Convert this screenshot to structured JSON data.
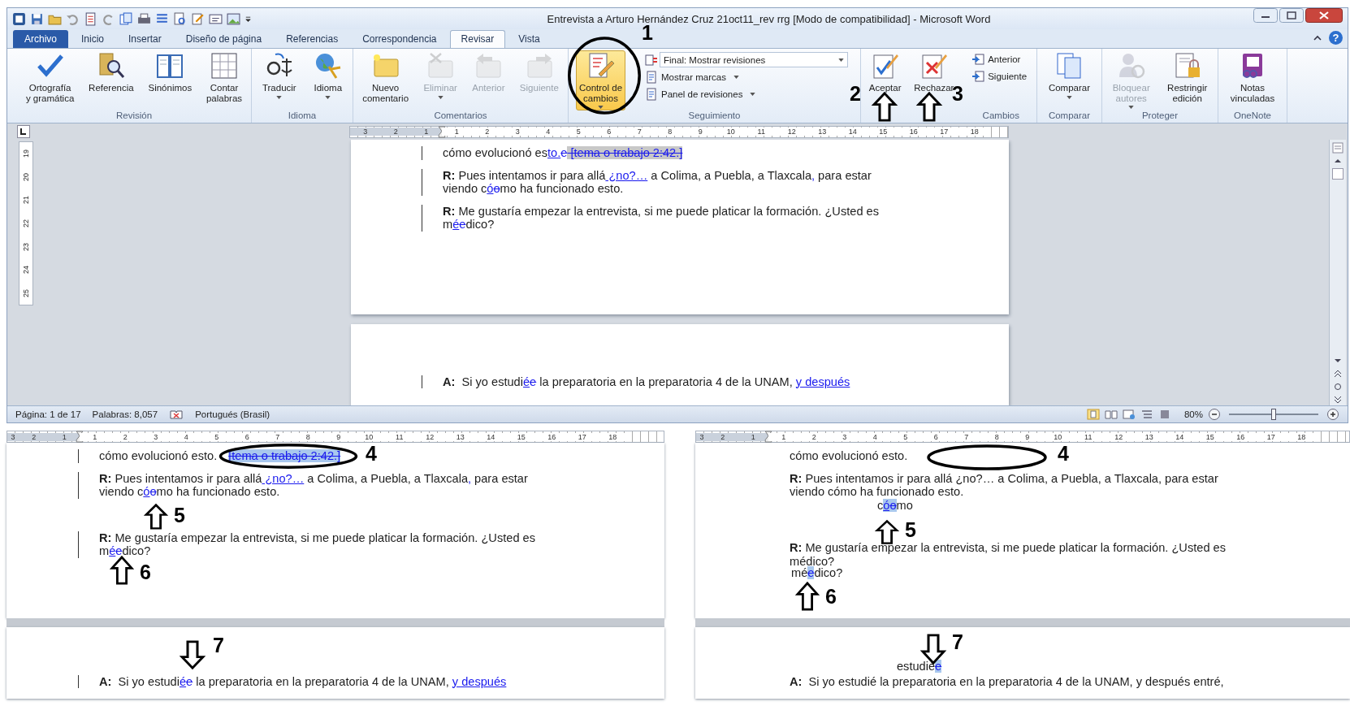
{
  "window": {
    "title": "Entrevista a Arturo Hernández Cruz 21oct11_rev rrg [Modo de compatibilidad]  -  Microsoft Word",
    "help": "?"
  },
  "tabs": [
    {
      "label": "Archivo",
      "selected": false,
      "kind": "file"
    },
    {
      "label": "Inicio",
      "selected": false,
      "kind": "tab"
    },
    {
      "label": "Insertar",
      "selected": false,
      "kind": "tab"
    },
    {
      "label": "Diseño de página",
      "selected": false,
      "kind": "tab"
    },
    {
      "label": "Referencias",
      "selected": false,
      "kind": "tab"
    },
    {
      "label": "Correspondencia",
      "selected": false,
      "kind": "tab"
    },
    {
      "label": "Revisar",
      "selected": true,
      "kind": "tab"
    },
    {
      "label": "Vista",
      "selected": false,
      "kind": "tab"
    }
  ],
  "ribbon": [
    {
      "label": "Revisión",
      "items": [
        {
          "kind": "large",
          "label": "Ortografía\ny gramática",
          "disabled": false,
          "menu": false,
          "on": false
        },
        {
          "kind": "large",
          "label": "Referencia",
          "disabled": false,
          "menu": false,
          "on": false
        },
        {
          "kind": "large",
          "label": "Sinónimos",
          "disabled": false,
          "menu": false,
          "on": false
        },
        {
          "kind": "large",
          "label": "Contar\npalabras",
          "disabled": false,
          "menu": false,
          "on": false
        }
      ]
    },
    {
      "label": "Idioma",
      "items": [
        {
          "kind": "large",
          "label": "Traducir",
          "disabled": false,
          "menu": true,
          "on": false
        },
        {
          "kind": "large",
          "label": "Idioma",
          "disabled": false,
          "menu": true,
          "on": false
        }
      ]
    },
    {
      "label": "Comentarios",
      "items": [
        {
          "kind": "large",
          "label": "Nuevo\ncomentario",
          "disabled": false,
          "menu": false,
          "on": false
        },
        {
          "kind": "large",
          "label": "Eliminar",
          "disabled": true,
          "menu": true,
          "on": false
        },
        {
          "kind": "large",
          "label": "Anterior",
          "disabled": true,
          "menu": false,
          "on": false
        },
        {
          "kind": "large",
          "label": "Siguiente",
          "disabled": true,
          "menu": false,
          "on": false
        }
      ]
    },
    {
      "label": "Seguimiento",
      "items": [
        {
          "kind": "large",
          "label": "Control de\ncambios",
          "disabled": false,
          "menu": true,
          "on": true
        },
        {
          "kind": "dropdown",
          "label": "Final: Mostrar revisiones",
          "disabled": false,
          "menu": true,
          "on": false
        },
        {
          "kind": "small",
          "label": "Mostrar marcas",
          "disabled": false,
          "menu": true,
          "on": false
        },
        {
          "kind": "small",
          "label": "Panel de revisiones",
          "disabled": false,
          "menu": true,
          "on": false
        }
      ]
    },
    {
      "label": "Cambios",
      "items": [
        {
          "kind": "large",
          "label": "Aceptar",
          "disabled": false,
          "menu": false,
          "on": false
        },
        {
          "kind": "large",
          "label": "Rechazar",
          "disabled": false,
          "menu": false,
          "on": false
        },
        {
          "kind": "small",
          "label": "Anterior",
          "disabled": false,
          "menu": false,
          "on": false
        },
        {
          "kind": "small",
          "label": "Siguiente",
          "disabled": false,
          "menu": false,
          "on": false
        }
      ]
    },
    {
      "label": "Comparar",
      "items": [
        {
          "kind": "large",
          "label": "Comparar",
          "disabled": false,
          "menu": true,
          "on": false
        }
      ]
    },
    {
      "label": "Proteger",
      "items": [
        {
          "kind": "large",
          "label": "Bloquear\nautores",
          "disabled": true,
          "menu": true,
          "on": false
        },
        {
          "kind": "large",
          "label": "Restringir\nedición",
          "disabled": false,
          "menu": false,
          "on": false
        }
      ]
    },
    {
      "label": "OneNote",
      "items": [
        {
          "kind": "large",
          "label": "Notas\nvinculadas",
          "disabled": false,
          "menu": false,
          "on": false
        }
      ]
    }
  ],
  "document": {
    "ruler": [
      "3",
      "2",
      "1",
      "1",
      "2",
      "3",
      "4",
      "5",
      "6",
      "7",
      "8",
      "9",
      "10",
      "11",
      "12",
      "13",
      "14",
      "15",
      "16",
      "17",
      "18"
    ],
    "vertical_ruler": [
      "19",
      "20",
      "21",
      "22",
      "23",
      "24",
      "25"
    ],
    "page_1": [
      {
        "kind": "text",
        "changed": true,
        "segments": [
          {
            "kind": "normal",
            "text": "cómo evolucionó es"
          },
          {
            "kind": "inserted",
            "text": "to."
          },
          {
            "kind": "deleted",
            "text": "e"
          },
          {
            "kind": "deleted-grey",
            "text": " [tema o trabajo 2:42.]"
          }
        ]
      },
      {
        "kind": "text",
        "changed": true,
        "segments": [
          {
            "kind": "bold",
            "text": "R:"
          },
          {
            "kind": "normal",
            "text": " Pues intentamos ir para allá"
          },
          {
            "kind": "inserted",
            "text": " ¿no?…"
          },
          {
            "kind": "normal",
            "text": " a Colima, a Puebla, a Tlaxcala"
          },
          {
            "kind": "inserted",
            "text": ","
          },
          {
            "kind": "normal",
            "text": " para estar viendo c"
          },
          {
            "kind": "inserted",
            "text": "ó"
          },
          {
            "kind": "deleted",
            "text": "o"
          },
          {
            "kind": "normal",
            "text": "mo ha funcionado esto."
          }
        ]
      },
      {
        "kind": "text",
        "changed": true,
        "segments": [
          {
            "kind": "bold",
            "text": "R:"
          },
          {
            "kind": "normal",
            "text": " Me gustaría empezar la entrevista, si me puede platicar la formación. ¿Usted es m"
          },
          {
            "kind": "inserted",
            "text": "é"
          },
          {
            "kind": "deleted",
            "text": "e"
          },
          {
            "kind": "normal",
            "text": "dico?"
          }
        ]
      }
    ],
    "page_2": [
      {
        "kind": "text",
        "changed": true,
        "segments": [
          {
            "kind": "bold",
            "text": "A:"
          },
          {
            "kind": "normal",
            "text": "  Si yo estudi"
          },
          {
            "kind": "inserted",
            "text": "é"
          },
          {
            "kind": "deleted",
            "text": "e"
          },
          {
            "kind": "normal",
            "text": " la preparatoria en la preparatoria 4 de la UNAM, "
          },
          {
            "kind": "inserted",
            "text": "y después"
          }
        ]
      }
    ]
  },
  "status_bar": {
    "page": "Página: 1 de 17",
    "words": "Palabras: 8,057",
    "language": "Portugués (Brasil)",
    "zoom": "80%",
    "zoom_level": {
      "level": 0.5
    }
  },
  "panels": [
    {
      "ruler": [
        "3",
        "2",
        "1",
        "1",
        "2",
        "3",
        "4",
        "5",
        "6",
        "7",
        "8",
        "9",
        "10",
        "11",
        "12",
        "13",
        "14",
        "15",
        "16",
        "17",
        "18"
      ],
      "page_1": [
        {
          "kind": "text",
          "changed": true,
          "segments": [
            {
              "kind": "normal",
              "text": "cómo evolucionó esto."
            },
            {
              "kind": "deleted-blue",
              "text": "[tema o trabajo 2:42.]"
            }
          ]
        },
        {
          "kind": "text",
          "changed": true,
          "segments": [
            {
              "kind": "bold",
              "text": "R:"
            },
            {
              "kind": "normal",
              "text": " Pues intentamos ir para allá"
            },
            {
              "kind": "inserted",
              "text": " ¿no?…"
            },
            {
              "kind": "normal",
              "text": " a Colima, a Puebla, a Tlaxcala"
            },
            {
              "kind": "inserted",
              "text": ","
            },
            {
              "kind": "normal",
              "text": " para estar viendo c"
            },
            {
              "kind": "inserted",
              "text": "ó"
            },
            {
              "kind": "deleted",
              "text": "o"
            },
            {
              "kind": "normal",
              "text": "mo ha funcionado esto."
            }
          ]
        },
        {
          "kind": "text",
          "changed": true,
          "segments": [
            {
              "kind": "bold",
              "text": "R:"
            },
            {
              "kind": "normal",
              "text": " Me gustaría empezar la entrevista, si me puede platicar la formación. ¿Usted es m"
            },
            {
              "kind": "inserted",
              "text": "é"
            },
            {
              "kind": "deleted",
              "text": "e"
            },
            {
              "kind": "normal",
              "text": "dico?"
            }
          ]
        }
      ],
      "page_2": [
        {
          "kind": "text",
          "changed": true,
          "segments": [
            {
              "kind": "bold",
              "text": "A:"
            },
            {
              "kind": "normal",
              "text": "  Si yo estudi"
            },
            {
              "kind": "inserted",
              "text": "é"
            },
            {
              "kind": "deleted",
              "text": "e"
            },
            {
              "kind": "normal",
              "text": " la preparatoria en la preparatoria 4 de la UNAM, "
            },
            {
              "kind": "inserted",
              "text": "y después"
            }
          ]
        }
      ]
    },
    {
      "ruler": [
        "3",
        "2",
        "1",
        "1",
        "2",
        "3",
        "4",
        "5",
        "6",
        "7",
        "8",
        "9",
        "10",
        "11",
        "12",
        "13",
        "14",
        "15",
        "16",
        "17",
        "18"
      ],
      "page_1": [
        {
          "kind": "text",
          "changed": false,
          "segments": [
            {
              "kind": "normal",
              "text": "cómo evolucionó esto."
            }
          ]
        },
        {
          "kind": "text",
          "changed": false,
          "segments": [
            {
              "kind": "bold",
              "text": "R:"
            },
            {
              "kind": "normal",
              "text": " Pues intentamos ir para allá ¿no?… a Colima, a Puebla, a Tlaxcala, para estar viendo cómo ha funcionado esto."
            }
          ]
        },
        {
          "kind": "snippet",
          "changed": false,
          "segments": [
            {
              "kind": "normal",
              "text": "c"
            },
            {
              "kind": "inserted-selected",
              "text": "ó"
            },
            {
              "kind": "deleted-selected",
              "text": "o"
            },
            {
              "kind": "normal",
              "text": "mo"
            }
          ]
        },
        {
          "kind": "text",
          "changed": false,
          "segments": [
            {
              "kind": "bold",
              "text": "R:"
            },
            {
              "kind": "normal",
              "text": " Me gustaría empezar la entrevista, si me puede platicar la formación. ¿Usted es médico?"
            }
          ]
        },
        {
          "kind": "snippet",
          "changed": false,
          "segments": [
            {
              "kind": "normal",
              "text": "mé"
            },
            {
              "kind": "deleted-selected",
              "text": "e"
            },
            {
              "kind": "normal",
              "text": "dico?"
            }
          ]
        }
      ],
      "page_2": [
        {
          "kind": "snippet",
          "changed": false,
          "segments": [
            {
              "kind": "normal",
              "text": "estudié"
            },
            {
              "kind": "deleted-selected",
              "text": "e"
            }
          ]
        },
        {
          "kind": "text",
          "changed": false,
          "segments": [
            {
              "kind": "bold",
              "text": "A:"
            },
            {
              "kind": "normal",
              "text": "  Si yo estudié la preparatoria en la preparatoria 4 de la UNAM, y después entré,"
            }
          ]
        }
      ]
    }
  ],
  "annotations": [
    {
      "kind": "ellipse",
      "label": "1"
    },
    {
      "kind": "arrow-up",
      "label": "2"
    },
    {
      "kind": "arrow-up",
      "label": "3"
    },
    {
      "kind": "ellipse",
      "label": "4"
    },
    {
      "kind": "arrow-up",
      "label": "5"
    },
    {
      "kind": "arrow-up",
      "label": "6"
    },
    {
      "kind": "arrow-down",
      "label": "7"
    },
    {
      "kind": "ellipse",
      "label": "4"
    },
    {
      "kind": "arrow-up",
      "label": "5"
    },
    {
      "kind": "arrow-up",
      "label": "6"
    },
    {
      "kind": "arrow-down",
      "label": "7"
    }
  ]
}
